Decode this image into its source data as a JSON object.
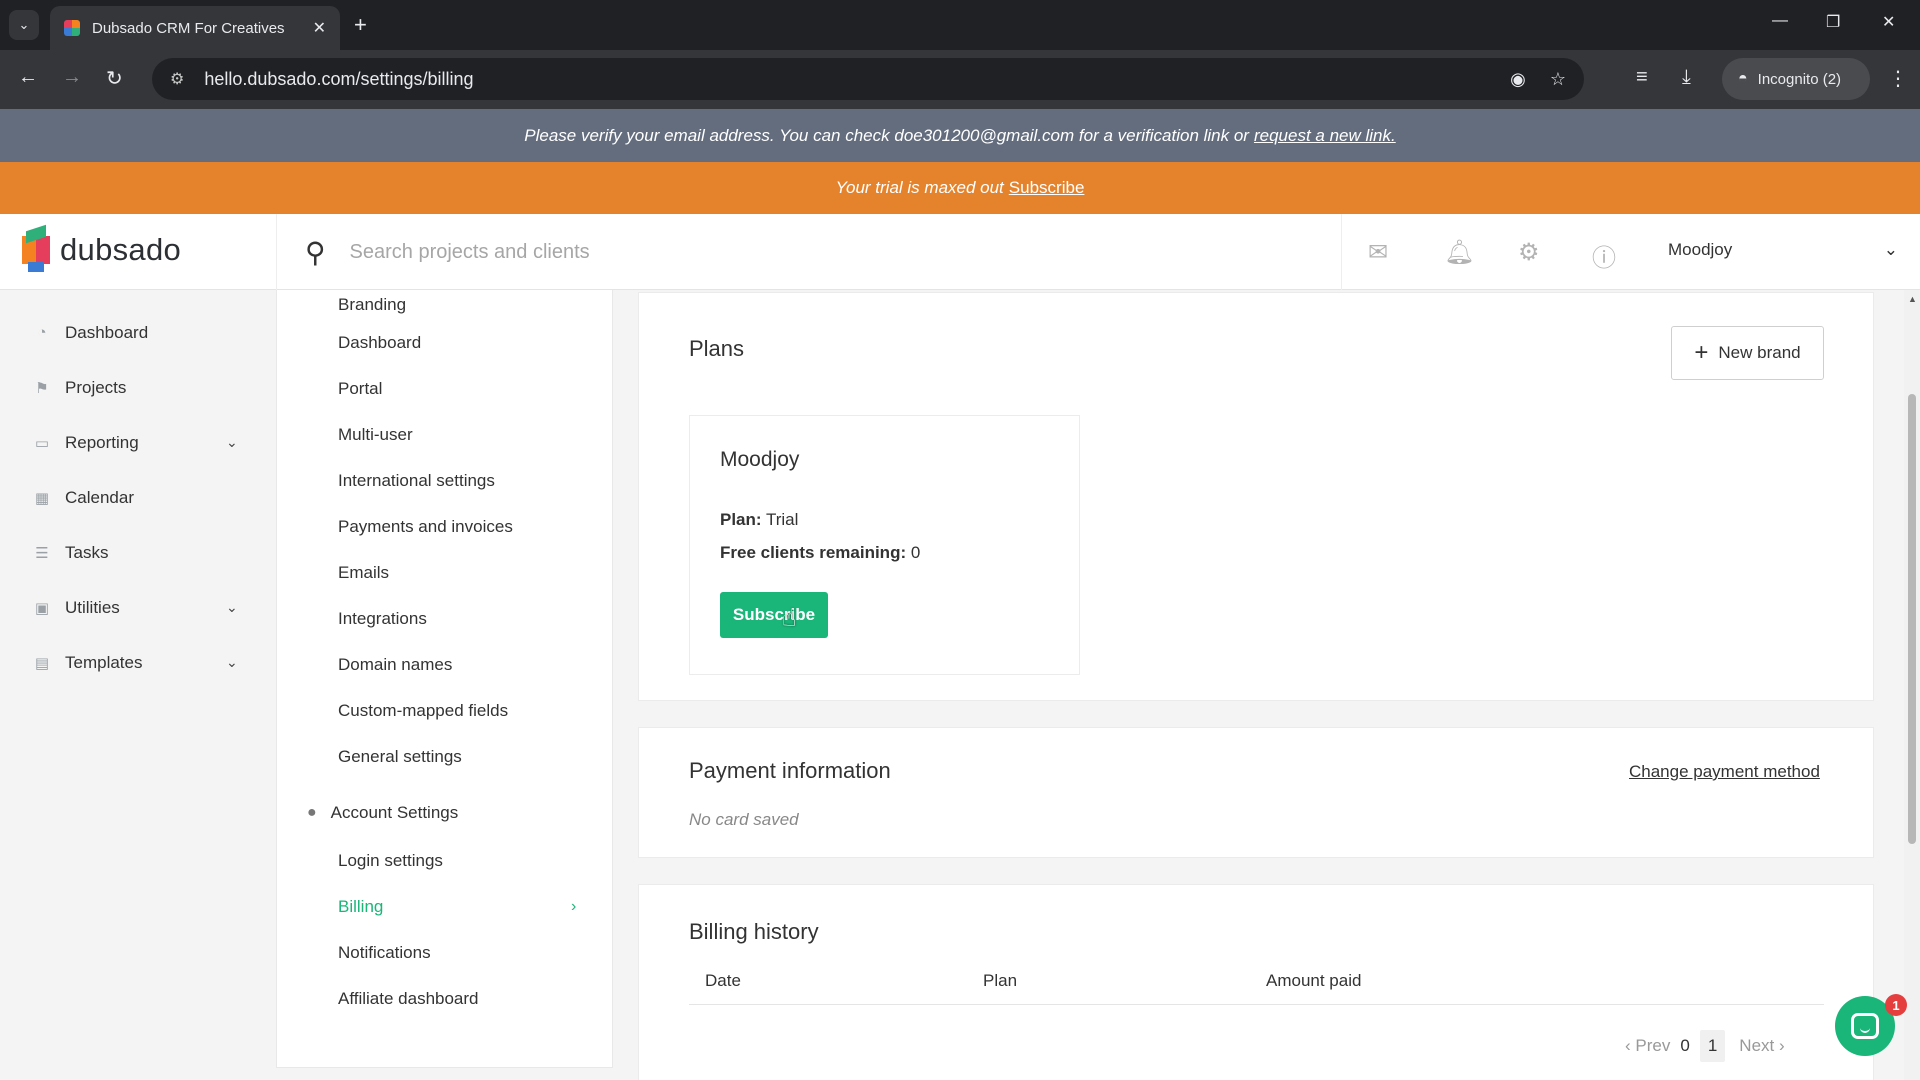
{
  "browser": {
    "tab_title": "Dubsado CRM For Creatives",
    "url": "hello.dubsado.com/settings/billing",
    "incognito_label": "Incognito (2)"
  },
  "banners": {
    "verify_text": "Please verify your email address. You can check doe301200@gmail.com for a verification link or",
    "verify_link": "request a new link.",
    "trial_text": "Your trial is maxed out",
    "trial_link": "Subscribe"
  },
  "header": {
    "logo_text": "dubsado",
    "search_placeholder": "Search projects and clients",
    "user_name": "Moodjoy"
  },
  "sidebar": {
    "items": [
      {
        "label": "Dashboard",
        "icon": "dashboard-icon"
      },
      {
        "label": "Projects",
        "icon": "projects-icon"
      },
      {
        "label": "Reporting",
        "icon": "reporting-icon"
      },
      {
        "label": "Calendar",
        "icon": "calendar-icon"
      },
      {
        "label": "Tasks",
        "icon": "tasks-icon"
      },
      {
        "label": "Utilities",
        "icon": "utilities-icon"
      },
      {
        "label": "Templates",
        "icon": "templates-icon"
      }
    ]
  },
  "settings_menu": {
    "brand_items": [
      "Branding",
      "Dashboard",
      "Portal",
      "Multi-user",
      "International settings",
      "Payments and invoices",
      "Emails",
      "Integrations",
      "Domain names",
      "Custom-mapped fields",
      "General settings"
    ],
    "account_section": "Account Settings",
    "account_items": [
      "Login settings",
      "Billing",
      "Notifications",
      "Affiliate dashboard"
    ]
  },
  "plans": {
    "title": "Plans",
    "new_brand_label": "New brand",
    "brand_name": "Moodjoy",
    "plan_label": "Plan:",
    "plan_value": "Trial",
    "free_clients_label": "Free clients remaining:",
    "free_clients_value": "0",
    "subscribe_label": "Subscribe"
  },
  "payment": {
    "title": "Payment information",
    "change_label": "Change payment method",
    "no_card": "No card saved"
  },
  "billing_history": {
    "title": "Billing history",
    "columns": [
      "Date",
      "Plan",
      "Amount paid"
    ],
    "prev_label": "Prev",
    "next_label": "Next",
    "page_first": "0",
    "page_current": "1"
  },
  "chat": {
    "badge": "1"
  },
  "colors": {
    "accent": "#1ab579",
    "trial_banner": "#e5832c",
    "verify_banner": "#636d7e"
  }
}
